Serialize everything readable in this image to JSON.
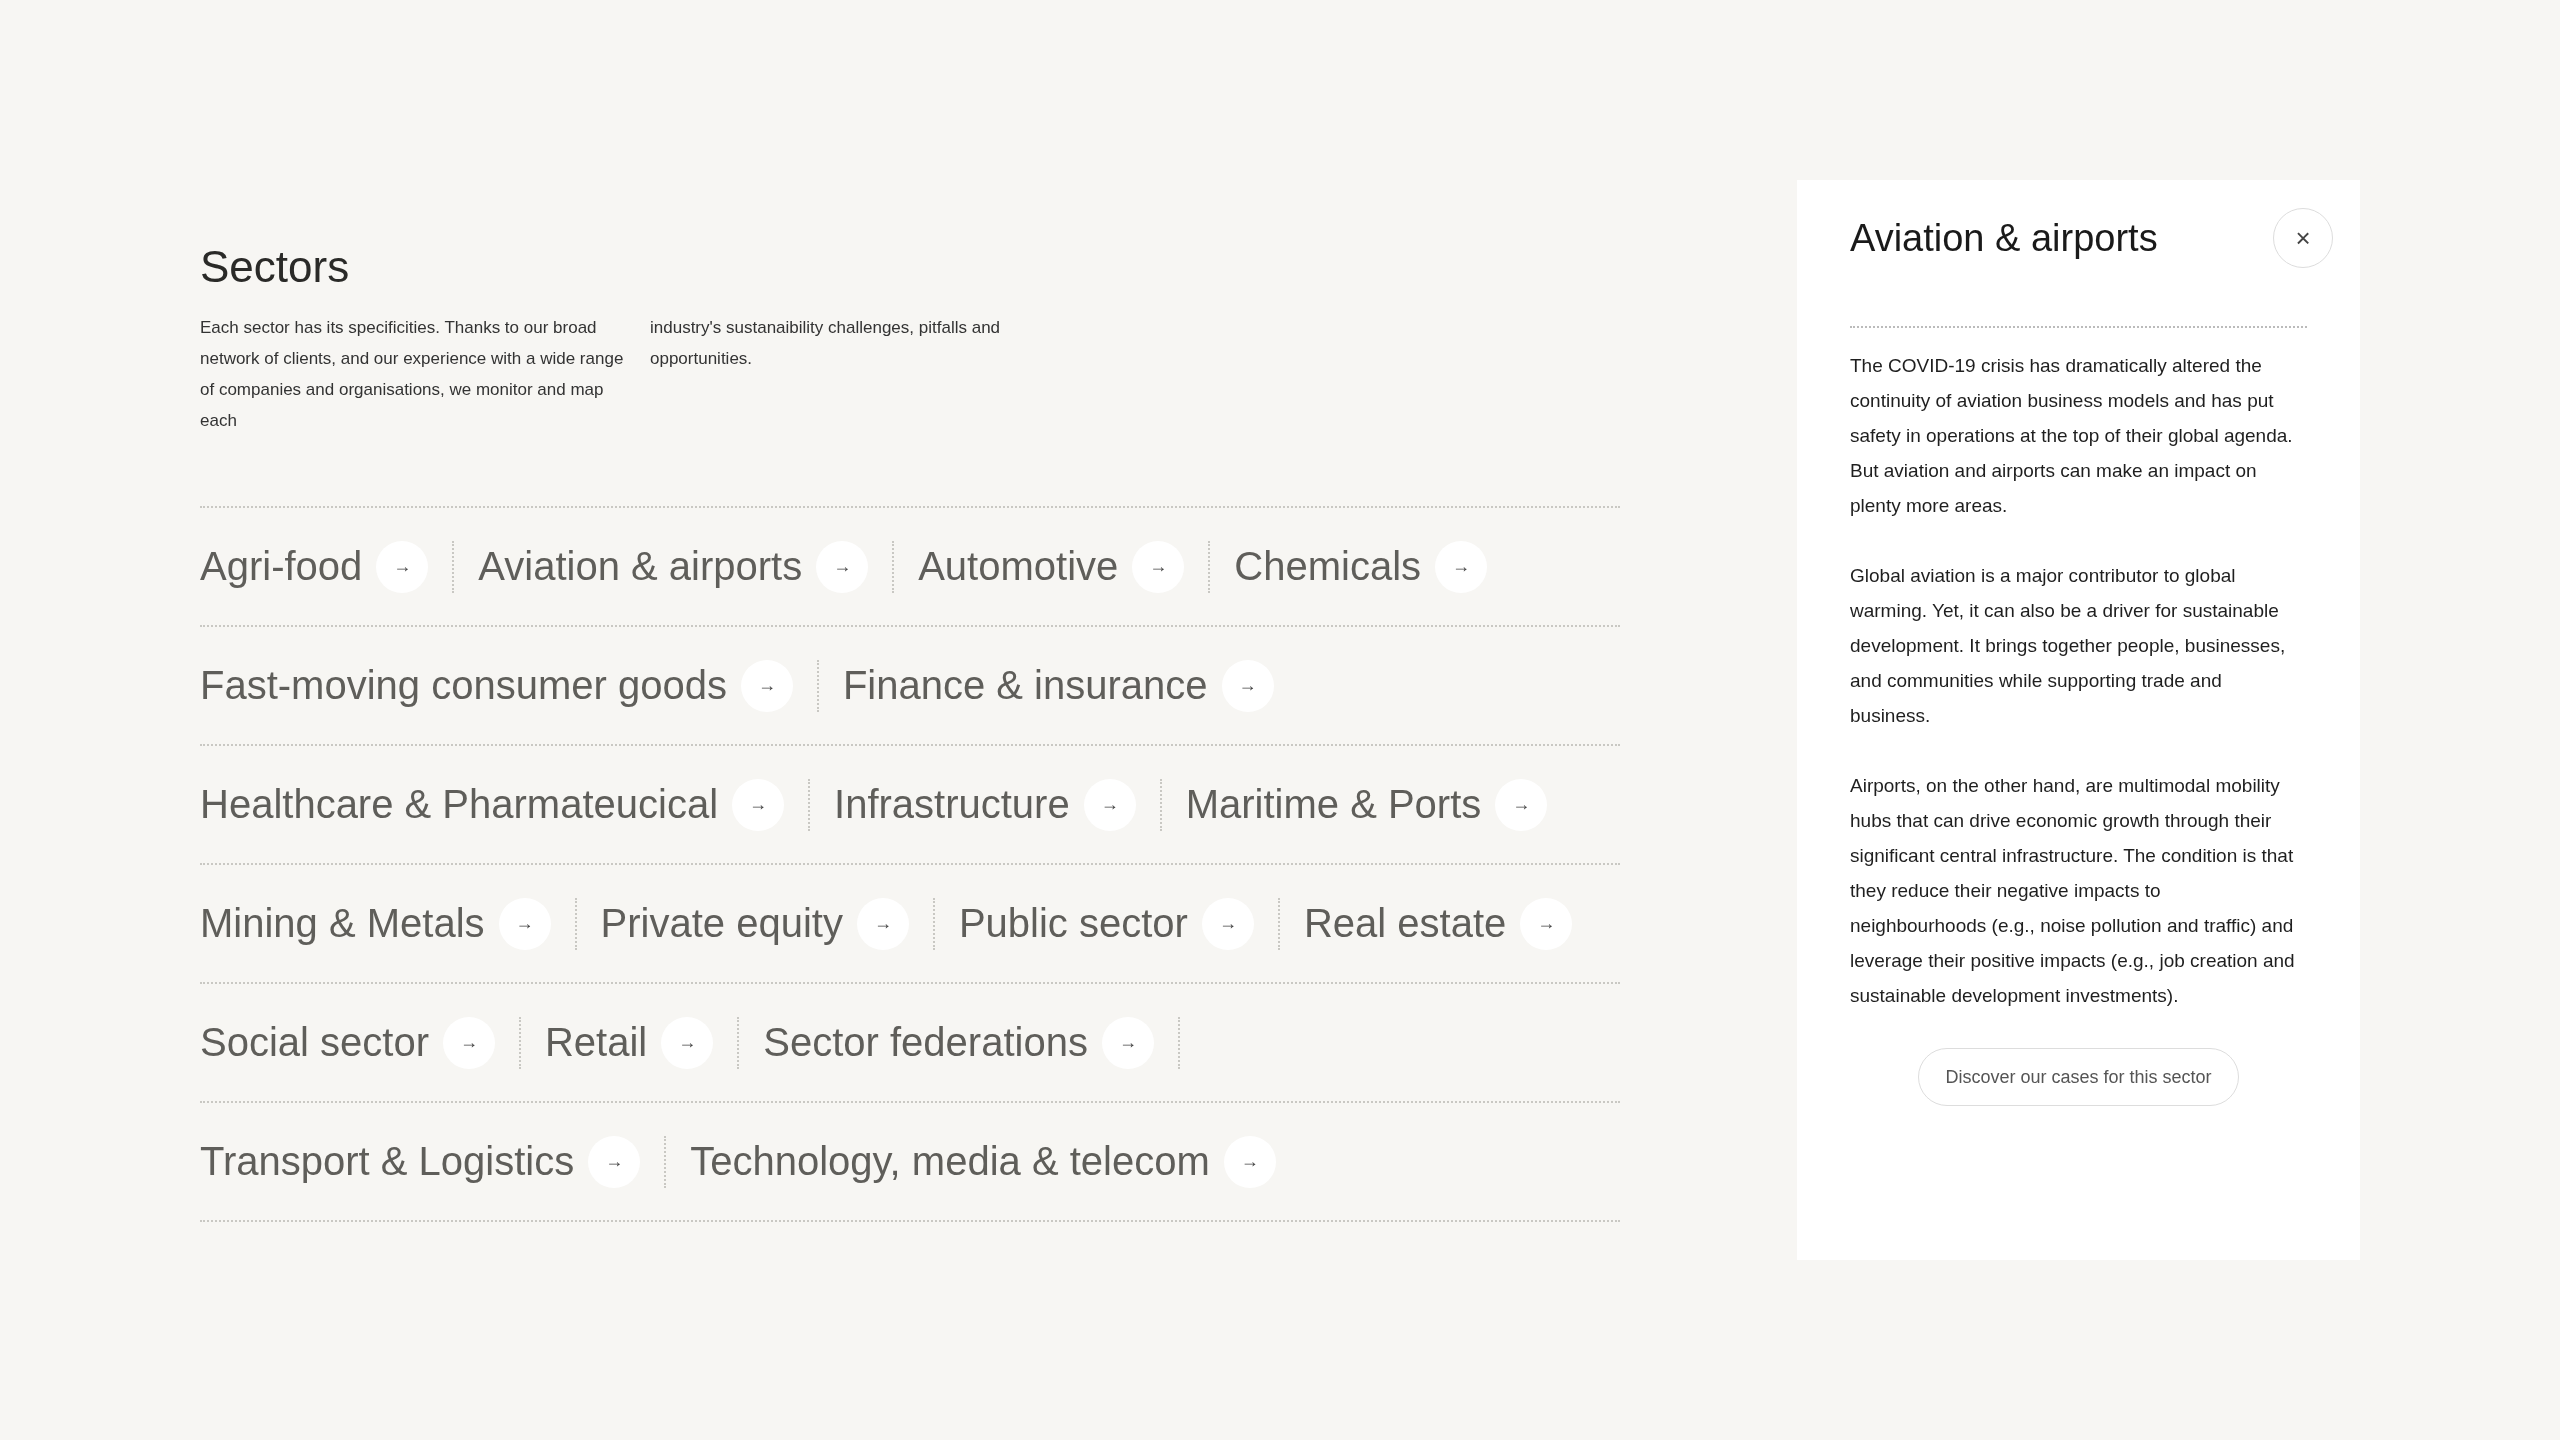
{
  "heading": "Sectors",
  "intro": [
    "Each sector has its specificities. Thanks to our broad network of clients, and our experience with a wide range of companies and organisations, we monitor and map each",
    "industry's sustanaibility challenges, pitfalls and opportunities."
  ],
  "rows": [
    {
      "trailing_divider": false,
      "items": [
        {
          "label": "Agri-food",
          "arrow": "→"
        },
        {
          "label": "Aviation & airports",
          "arrow": "→"
        },
        {
          "label": "Automotive",
          "arrow": "→"
        },
        {
          "label": "Chemicals",
          "arrow": "→"
        }
      ]
    },
    {
      "trailing_divider": false,
      "items": [
        {
          "label": "Fast-moving consumer goods",
          "arrow": "→"
        },
        {
          "label": "Finance & insurance",
          "arrow": "→"
        }
      ]
    },
    {
      "trailing_divider": false,
      "items": [
        {
          "label": "Healthcare & Pharmateucical",
          "arrow": "→"
        },
        {
          "label": "Infrastructure",
          "arrow": "→"
        },
        {
          "label": "Maritime & Ports",
          "arrow": "→"
        }
      ]
    },
    {
      "trailing_divider": false,
      "items": [
        {
          "label": "Mining & Metals",
          "arrow": "→"
        },
        {
          "label": "Private equity",
          "arrow": "→"
        },
        {
          "label": "Public sector",
          "arrow": "→"
        },
        {
          "label": "Real estate",
          "arrow": "→"
        }
      ]
    },
    {
      "trailing_divider": true,
      "items": [
        {
          "label": "Social sector",
          "arrow": "→"
        },
        {
          "label": "Retail",
          "arrow": "→"
        },
        {
          "label": "Sector federations",
          "arrow": "→"
        }
      ]
    },
    {
      "trailing_divider": false,
      "items": [
        {
          "label": "Transport & Logistics",
          "arrow": "→"
        },
        {
          "label": "Technology, media & telecom",
          "arrow": "→"
        }
      ]
    }
  ],
  "panel": {
    "title": "Aviation & airports",
    "close": "×",
    "paragraphs": [
      "The COVID-19 crisis has dramatically altered the continuity of aviation business models and has put safety in operations at the top of their global agenda. But aviation and airports can make an impact on plenty more areas.",
      "Global aviation is a major contributor to global warming. Yet, it can also be a driver for sustainable development. It brings together people, businesses, and communities while supporting trade and business.",
      "Airports, on the other hand, are multimodal mobility hubs that can drive economic growth through their significant central infrastructure. The condition is that they reduce their negative impacts to neighbourhoods (e.g., noise pollution and traffic) and leverage their positive impacts (e.g., job creation and sustainable development investments)."
    ],
    "button": "Discover our cases for this sector"
  }
}
